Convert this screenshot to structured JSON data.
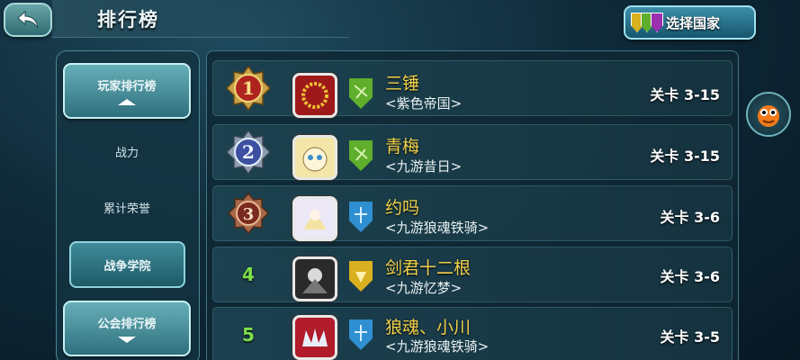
{
  "header": {
    "title": "排行榜",
    "select_country_label": "选择国家"
  },
  "sidebar": {
    "player_ranking": "玩家排行榜",
    "items": [
      {
        "label": "战力"
      },
      {
        "label": "累计荣誉"
      },
      {
        "label": "战争学院"
      }
    ],
    "guild_ranking": "公会排行榜"
  },
  "rows": [
    {
      "rank": "1",
      "name": "三锤",
      "guild": "<紫色帝国>",
      "stage": "关卡 3-15",
      "shield_color": "#5fae2c"
    },
    {
      "rank": "2",
      "name": "青梅",
      "guild": "<九游昔日>",
      "stage": "关卡 3-15",
      "shield_color": "#5fae2c"
    },
    {
      "rank": "3",
      "name": "约吗",
      "guild": "<九游狼魂铁骑>",
      "stage": "关卡 3-6",
      "shield_color": "#2f8fd0"
    },
    {
      "rank": "4",
      "name": "剑君十二根",
      "guild": "<九游忆梦>",
      "stage": "关卡 3-6",
      "shield_color": "#d8b020"
    },
    {
      "rank": "5",
      "name": "狼魂、小川",
      "guild": "<九游狼魂铁骑>",
      "stage": "关卡 3-5",
      "shield_color": "#2f8fd0"
    }
  ],
  "colors": {
    "accent": "#f2d24a",
    "rank_number": "#7ee04a"
  }
}
